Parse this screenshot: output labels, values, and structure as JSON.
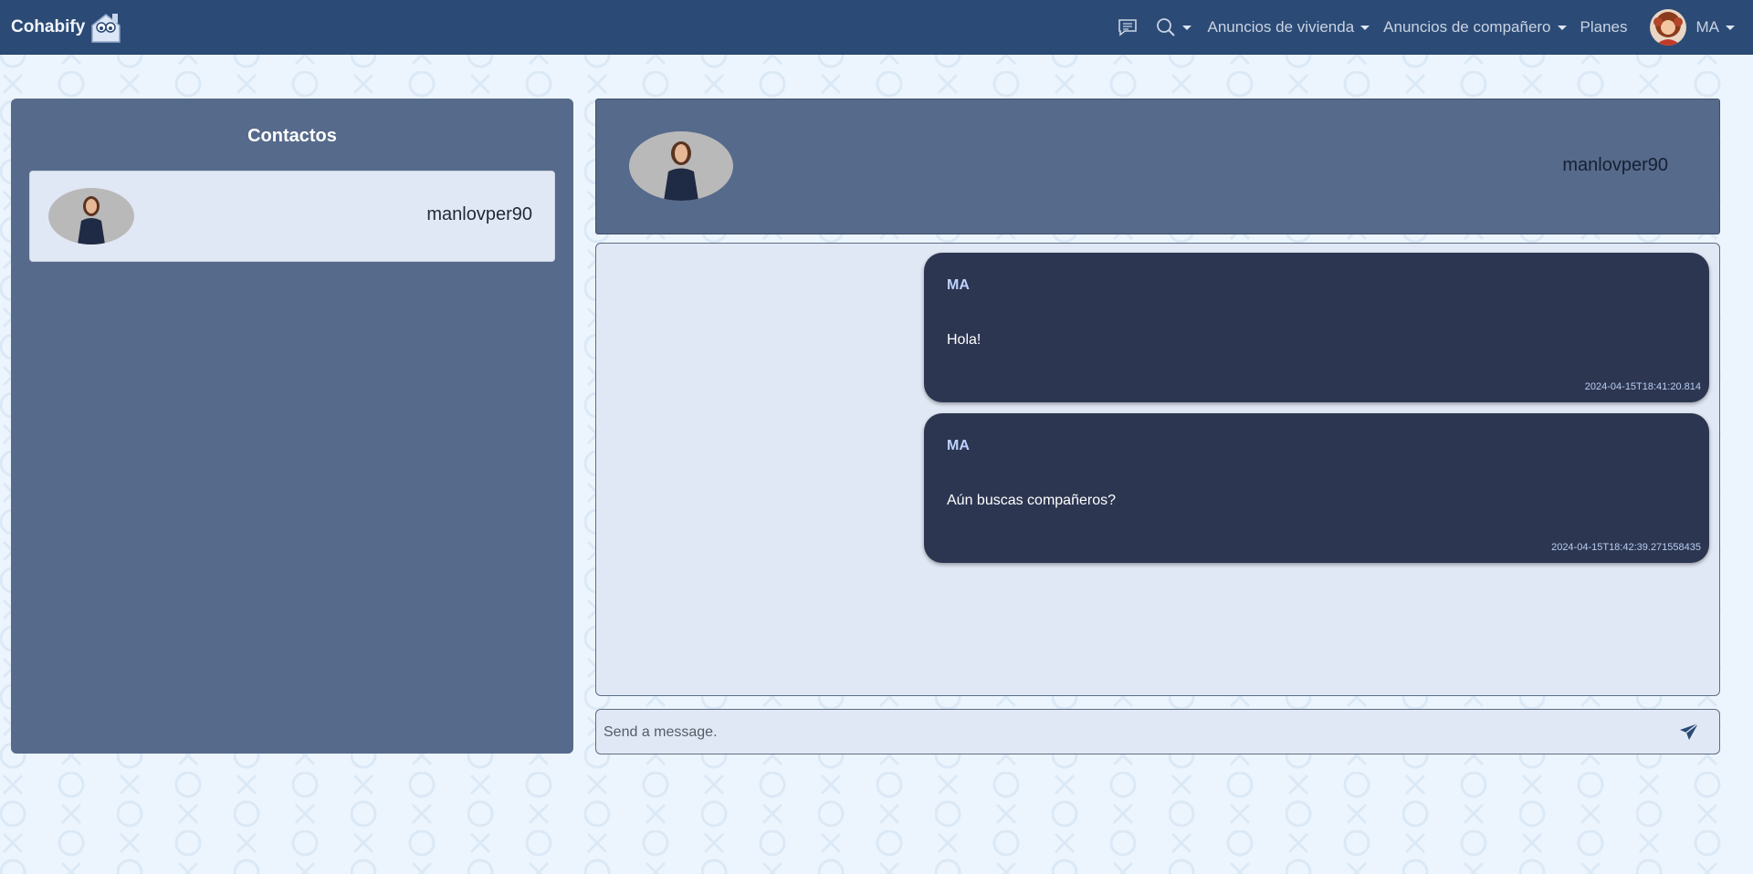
{
  "navbar": {
    "brand": "Cohabify",
    "menus": [
      {
        "label": "Anuncios de vivienda"
      },
      {
        "label": "Anuncios de compañero"
      },
      {
        "label": "Planes"
      }
    ],
    "user_initials": "MA",
    "icons": [
      "chat-icon",
      "search-icon",
      "avatar"
    ]
  },
  "contacts": {
    "title": "Contactos",
    "items": [
      {
        "username": "manlovper90"
      }
    ]
  },
  "chat": {
    "header_username": "manlovper90",
    "messages": [
      {
        "sender": "MA",
        "text": "Hola!",
        "timestamp": "2024-04-15T18:41:20.814"
      },
      {
        "sender": "MA",
        "text": "Aún buscas compañeros?",
        "timestamp": "2024-04-15T18:42:39.271558435"
      }
    ],
    "input": {
      "placeholder": "Send a message.",
      "value": ""
    }
  },
  "colors": {
    "navbar": "#2b4a75",
    "panel": "#566a8b",
    "card": "#e1e8f5",
    "message_bubble": "#2d3651",
    "sender_text": "#bcd2ff",
    "page_background": "#ecf5fd"
  }
}
